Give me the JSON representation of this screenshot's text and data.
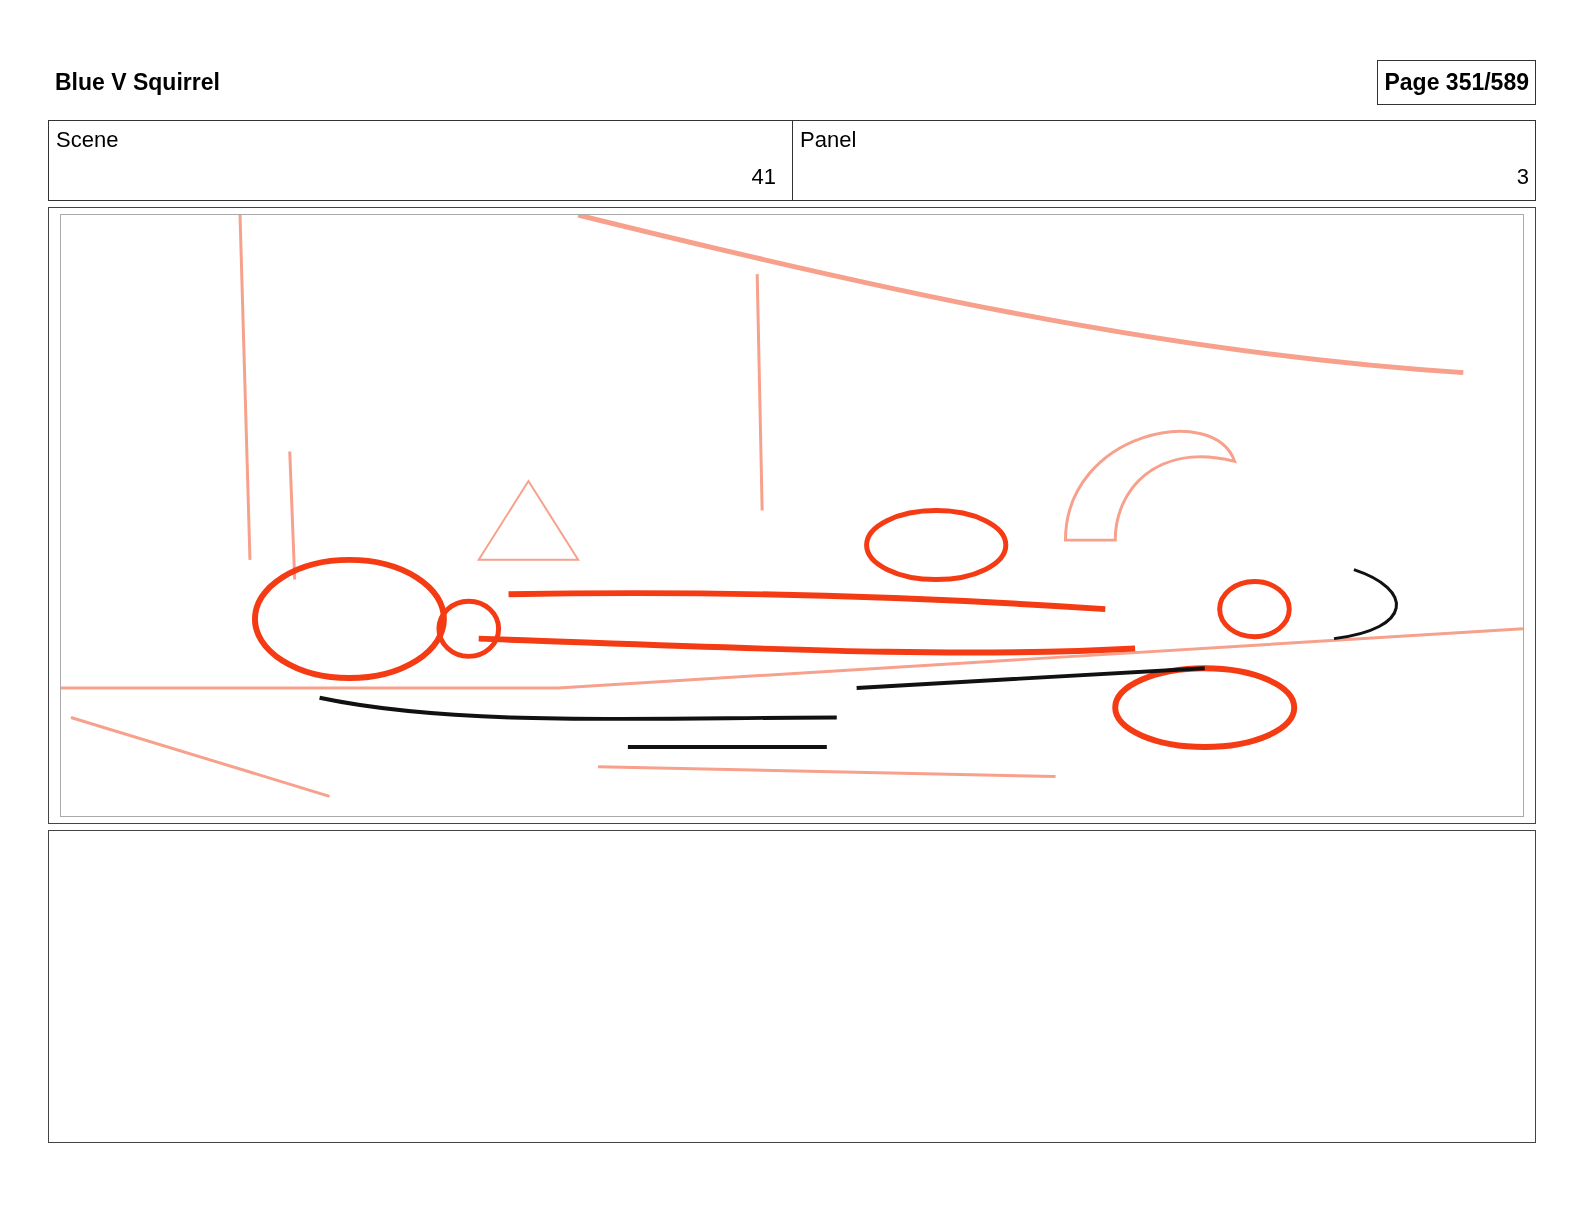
{
  "title": "Blue V Squirrel",
  "page": "Page 351/589",
  "fields": [
    {
      "label": "Scene",
      "value": "41"
    },
    {
      "label": "Panel",
      "value": "3"
    }
  ]
}
